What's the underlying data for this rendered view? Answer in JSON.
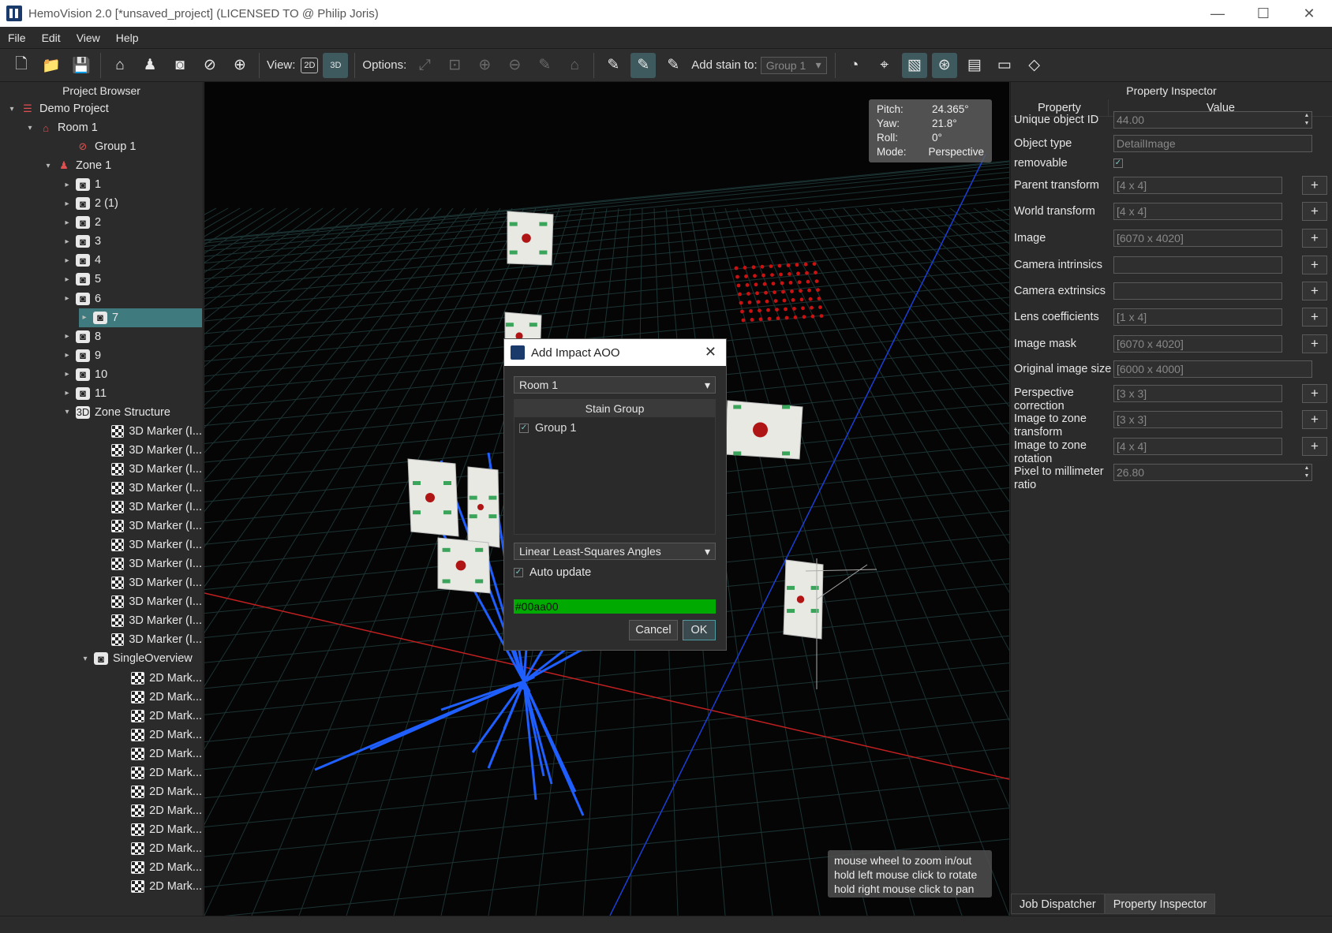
{
  "window": {
    "title": "HemoVision 2.0 [*unsaved_project] (LICENSED TO @ Philip Joris)",
    "controls": [
      "—",
      "☐",
      "✕"
    ]
  },
  "menu": [
    "File",
    "Edit",
    "View",
    "Help"
  ],
  "toolbar": {
    "view_label": "View:",
    "options_label": "Options:",
    "add_stain_label": "Add stain to:",
    "add_stain_value": "Group 1",
    "view_2d": "2D",
    "view_3d": "3D"
  },
  "browser": {
    "header": "Project Browser",
    "project": "Demo Project",
    "room": "Room 1",
    "group": "Group 1",
    "zone": "Zone 1",
    "cameras": [
      "1",
      "2 (1)",
      "2",
      "3",
      "4",
      "5",
      "6",
      "7",
      "8",
      "9",
      "10",
      "11"
    ],
    "selected_camera": "7",
    "zone_structure": "Zone Structure",
    "markers_3d": [
      "3D Marker (I...",
      "3D Marker (I...",
      "3D Marker (I...",
      "3D Marker (I...",
      "3D Marker (I...",
      "3D Marker (I...",
      "3D Marker (I...",
      "3D Marker (I...",
      "3D Marker (I...",
      "3D Marker (I...",
      "3D Marker (I...",
      "3D Marker (I..."
    ],
    "overview": "SingleOverview",
    "markers_2d": [
      "2D Mark...",
      "2D Mark...",
      "2D Mark...",
      "2D Mark...",
      "2D Mark...",
      "2D Mark...",
      "2D Mark...",
      "2D Mark...",
      "2D Mark...",
      "2D Mark...",
      "2D Mark...",
      "2D Mark..."
    ]
  },
  "viewport_info": {
    "pitch_label": "Pitch:",
    "pitch": "24.365°",
    "yaw_label": "Yaw:",
    "yaw": "21.8°",
    "roll_label": "Roll:",
    "roll": "0°",
    "mode_label": "Mode:",
    "mode": "Perspective"
  },
  "hint": {
    "line1": "mouse wheel to zoom in/out",
    "line2": "hold left mouse click to rotate",
    "line3": "hold right mouse click to pan"
  },
  "dialog": {
    "title": "Add Impact AOO",
    "room_value": "Room 1",
    "list_header": "Stain Group",
    "list_item": "Group 1",
    "method_value": "Linear Least-Squares Angles",
    "auto_update": "Auto update",
    "color_value": "#00aa00",
    "cancel": "Cancel",
    "ok": "OK",
    "close": "✕"
  },
  "inspector": {
    "header": "Property Inspector",
    "col_property": "Property",
    "col_value": "Value",
    "rows": [
      {
        "name": "Unique object ID",
        "value": "44.00"
      },
      {
        "name": "Object type",
        "value": "DetailImage"
      },
      {
        "name": "removable",
        "value": ""
      },
      {
        "name": "Parent transform",
        "value": "[4 x 4]"
      },
      {
        "name": "World transform",
        "value": "[4 x 4]"
      },
      {
        "name": "Image",
        "value": "[6070 x 4020]"
      },
      {
        "name": "Camera intrinsics",
        "value": ""
      },
      {
        "name": "Camera extrinsics",
        "value": ""
      },
      {
        "name": "Lens coefficients",
        "value": "[1 x 4]"
      },
      {
        "name": "Image mask",
        "value": "[6070 x 4020]"
      },
      {
        "name": "Original image size",
        "value": "[6000 x 4000]"
      },
      {
        "name": "Perspective correction",
        "value": "[3 x 3]"
      },
      {
        "name": "Image to zone transform",
        "value": "[3 x 3]"
      },
      {
        "name": "Image to zone rotation",
        "value": "[4 x 4]"
      },
      {
        "name": "Pixel to millimeter ratio",
        "value": "26.80"
      }
    ],
    "plus": "+",
    "tab_jobs": "Job Dispatcher",
    "tab_inspector": "Property Inspector"
  },
  "colors": {
    "accent_selection": "#3f7b7e",
    "stain_color": "#00aa00",
    "trajectory_blue": "#1f5fff",
    "axis_red": "#c42020"
  }
}
